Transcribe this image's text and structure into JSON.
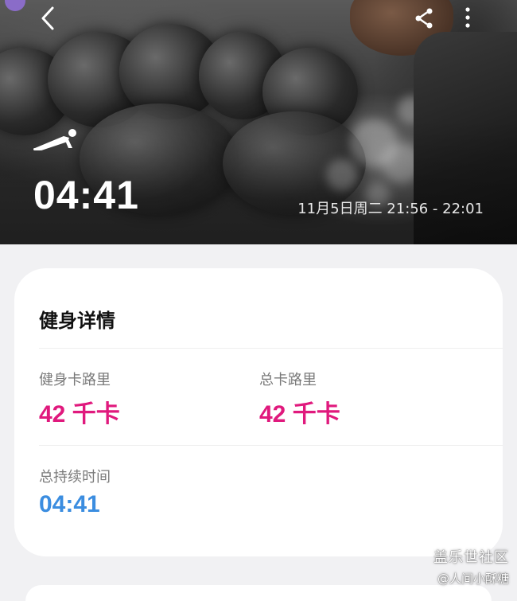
{
  "header": {
    "back_icon": "chevron-left-icon",
    "share_icon": "share-icon",
    "more_icon": "more-vertical-icon",
    "workout_icon": "push-up-icon",
    "duration": "04:41",
    "datetime": "11月5日周二 21:56 - 22:01"
  },
  "details": {
    "title": "健身详情",
    "workout_calories": {
      "label": "健身卡路里",
      "value": "42 千卡"
    },
    "total_calories": {
      "label": "总卡路里",
      "value": "42 千卡"
    },
    "total_duration": {
      "label": "总持续时间",
      "value": "04:41"
    }
  },
  "colors": {
    "calorie_accent": "#e0197d",
    "duration_accent": "#3b8de0"
  },
  "watermark": {
    "line1": "盖乐世社区",
    "line2": "@人间小酥糖"
  }
}
